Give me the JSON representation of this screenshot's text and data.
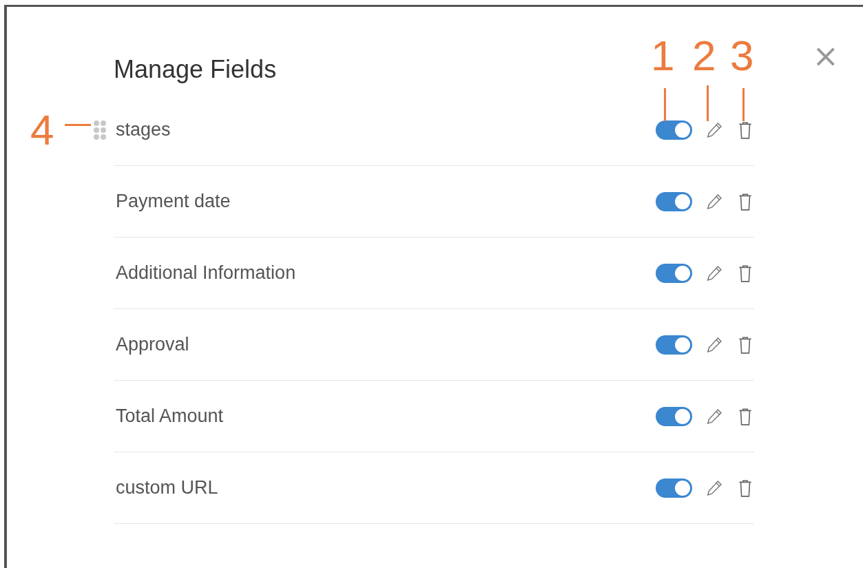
{
  "dialog": {
    "title": "Manage Fields",
    "close": "×"
  },
  "fields": [
    {
      "name": "stages",
      "on": true,
      "hovered": true
    },
    {
      "name": "Payment date",
      "on": true,
      "hovered": false
    },
    {
      "name": "Additional Information",
      "on": true,
      "hovered": false
    },
    {
      "name": "Approval",
      "on": true,
      "hovered": false
    },
    {
      "name": "Total Amount",
      "on": true,
      "hovered": false
    },
    {
      "name": "custom URL",
      "on": true,
      "hovered": false
    }
  ],
  "callouts": [
    {
      "label": "1",
      "kind": "toggle"
    },
    {
      "label": "2",
      "kind": "edit"
    },
    {
      "label": "3",
      "kind": "delete"
    },
    {
      "label": "4",
      "kind": "handle"
    }
  ]
}
